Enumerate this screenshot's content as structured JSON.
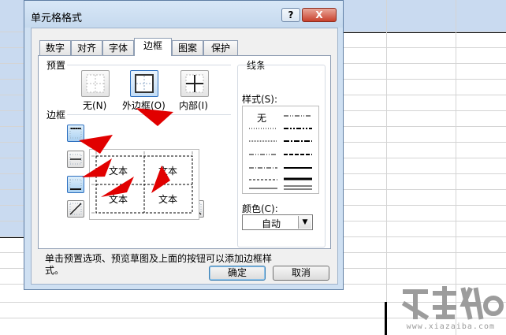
{
  "dialog": {
    "title": "单元格格式",
    "help_label": "?",
    "close_label": "X",
    "tabs": [
      {
        "label": "数字"
      },
      {
        "label": "对齐"
      },
      {
        "label": "字体"
      },
      {
        "label": "边框"
      },
      {
        "label": "图案"
      },
      {
        "label": "保护"
      }
    ],
    "active_tab": "边框",
    "presets": {
      "group_label": "预置",
      "none_label": "无(N)",
      "outline_label": "外边框(O)",
      "inside_label": "内部(I)"
    },
    "border": {
      "group_label": "边框",
      "preview_text": [
        "文本",
        "文本",
        "文本",
        "文本"
      ]
    },
    "line": {
      "group_label": "线条",
      "style_label": "样式(S):",
      "none_style_label": "无",
      "color_label": "颜色(C):",
      "color_value": "自动"
    },
    "hint": "单击预置选项、预览草图及上面的按钮可以添加边框样式。",
    "ok_label": "确定",
    "cancel_label": "取消"
  },
  "watermark": {
    "text": "www.xiazaiba.com"
  },
  "colors": {
    "arrow": "#e10000",
    "selection": "#c9daf0",
    "accent": "#2d6fbf"
  }
}
